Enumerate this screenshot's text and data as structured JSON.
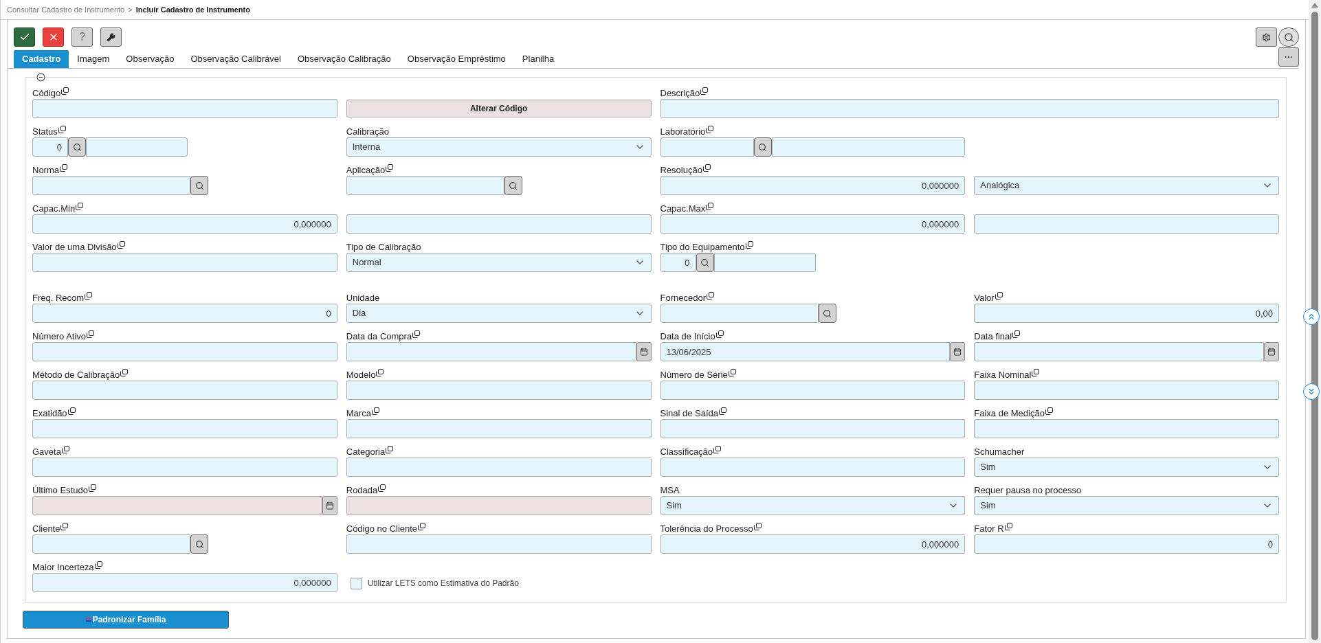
{
  "breadcrumb": {
    "parent": "Consultar Cadastro de Instrumento",
    "separator": ">",
    "current": "Incluir Cadastro de Instrumento"
  },
  "tabs": [
    {
      "label": "Cadastro",
      "selected": true
    },
    {
      "label": "Imagem",
      "selected": false
    },
    {
      "label": "Observação",
      "selected": false
    },
    {
      "label": "Observação Calibrável",
      "selected": false
    },
    {
      "label": "Observação Calibração",
      "selected": false
    },
    {
      "label": "Observação Empréstimo",
      "selected": false
    },
    {
      "label": "Planilha",
      "selected": false
    }
  ],
  "help_button": "?",
  "more_button": "···",
  "groups": [
    [
      [
        {
          "kind": "text",
          "label": "Código",
          "copy": true,
          "disabled": false
        },
        {
          "kind": "button",
          "label": "Alterar Código"
        },
        {
          "kind": "wide",
          "label": "Descrição",
          "copy": true,
          "disabled": false
        }
      ],
      [
        {
          "kind": "code-lookup",
          "label": "Status",
          "copy": true,
          "value": "0",
          "disabled": false
        },
        {
          "kind": "select",
          "label": "Calibração",
          "copy": false,
          "value": "Interna",
          "disabled": false
        },
        {
          "kind": "code-lookup",
          "label": "Laboratório",
          "copy": true,
          "disabled": false
        }
      ],
      [
        {
          "kind": "lookup",
          "label": "Norma",
          "copy": true,
          "disabled": false
        },
        {
          "kind": "lookup",
          "label": "Aplicação",
          "copy": true,
          "disabled": false
        },
        {
          "kind": "number",
          "label": "Resolução",
          "copy": true,
          "value": "0,000000",
          "disabled": false
        },
        {
          "kind": "select",
          "value": "Analógica",
          "disabled": false
        }
      ],
      [
        {
          "kind": "number",
          "label": "Capac.Min",
          "copy": true,
          "value": "0,000000",
          "disabled": false
        },
        {
          "kind": "text",
          "disabled": false
        },
        {
          "kind": "number",
          "label": "Capac.Max",
          "copy": true,
          "value": "0,000000",
          "disabled": false
        },
        {
          "kind": "text",
          "disabled": false
        }
      ],
      [
        {
          "kind": "text",
          "label": "Valor de uma Divisão",
          "copy": true,
          "disabled": false
        },
        {
          "kind": "select",
          "label": "Tipo de Calibração",
          "copy": false,
          "value": "Normal",
          "disabled": false
        },
        {
          "kind": "code-lookup",
          "label": "Tipo do Equipamento",
          "copy": true,
          "value": "0",
          "disabled": false
        }
      ]
    ],
    [
      [
        {
          "kind": "number",
          "label": "Freq. Recom",
          "copy": true,
          "value": "0",
          "disabled": false
        },
        {
          "kind": "select",
          "label": "Unidade",
          "copy": false,
          "value": "Dia",
          "disabled": false
        },
        {
          "kind": "lookup",
          "label": "Fornecedor",
          "copy": true,
          "disabled": false
        },
        {
          "kind": "number",
          "label": "Valor",
          "copy": true,
          "value": "0,00",
          "disabled": false
        }
      ],
      [
        {
          "kind": "text",
          "label": "Número Ativo",
          "copy": true,
          "disabled": false
        },
        {
          "kind": "date",
          "label": "Data da Compra",
          "copy": true,
          "disabled": false
        },
        {
          "kind": "date",
          "label": "Data de Início",
          "copy": true,
          "value": "13/06/2025",
          "disabled": false
        },
        {
          "kind": "date",
          "label": "Data final",
          "copy": true,
          "disabled": false
        }
      ],
      [
        {
          "kind": "text",
          "label": "Método de Calibração",
          "copy": true,
          "disabled": false
        },
        {
          "kind": "text",
          "label": "Modelo",
          "copy": true,
          "disabled": false
        },
        {
          "kind": "text",
          "label": "Número de Série",
          "copy": true,
          "disabled": false
        },
        {
          "kind": "text",
          "label": "Faixa Nominal",
          "copy": true,
          "disabled": false
        }
      ],
      [
        {
          "kind": "text",
          "label": "Exatidão",
          "copy": true,
          "disabled": false
        },
        {
          "kind": "text",
          "label": "Marca",
          "copy": true,
          "disabled": false
        },
        {
          "kind": "text",
          "label": "Sinal de Saída",
          "copy": true,
          "disabled": false
        },
        {
          "kind": "text",
          "label": "Faixa de Medição",
          "copy": true,
          "disabled": false
        }
      ],
      [
        {
          "kind": "text",
          "label": "Gaveta",
          "copy": true,
          "disabled": false
        },
        {
          "kind": "text",
          "label": "Categoria",
          "copy": true,
          "disabled": false
        },
        {
          "kind": "text",
          "label": "Classificação",
          "copy": true,
          "disabled": false
        },
        {
          "kind": "select",
          "label": "Schumacher",
          "copy": false,
          "value": "Sim",
          "disabled": false
        }
      ],
      [
        {
          "kind": "date",
          "label": "Último Estudo",
          "copy": true,
          "disabled": true
        },
        {
          "kind": "text",
          "label": "Rodada",
          "copy": true,
          "disabled": true
        },
        {
          "kind": "select",
          "label": "MSA",
          "copy": false,
          "value": "Sim",
          "disabled": false
        },
        {
          "kind": "select",
          "label": "Requer pausa no processo",
          "copy": false,
          "value": "Sim",
          "disabled": false
        }
      ],
      [
        {
          "kind": "lookup",
          "label": "Cliente",
          "copy": true,
          "disabled": false
        },
        {
          "kind": "text",
          "label": "Código no Cliente",
          "copy": true,
          "disabled": false
        },
        {
          "kind": "number",
          "label": "Tolerência do Processo",
          "copy": true,
          "value": "0,000000",
          "disabled": false
        },
        {
          "kind": "number",
          "label": "Fator R",
          "copy": true,
          "value": "0",
          "disabled": false
        }
      ],
      [
        {
          "kind": "number",
          "label": "Maior Incerteza",
          "copy": true,
          "value": "0,000000",
          "disabled": false
        },
        {
          "kind": "checkbox",
          "label": "Utilizar LETS como Estimativa do Padrão",
          "checked": false
        }
      ]
    ]
  ],
  "footer_button": "Padronizar Família"
}
